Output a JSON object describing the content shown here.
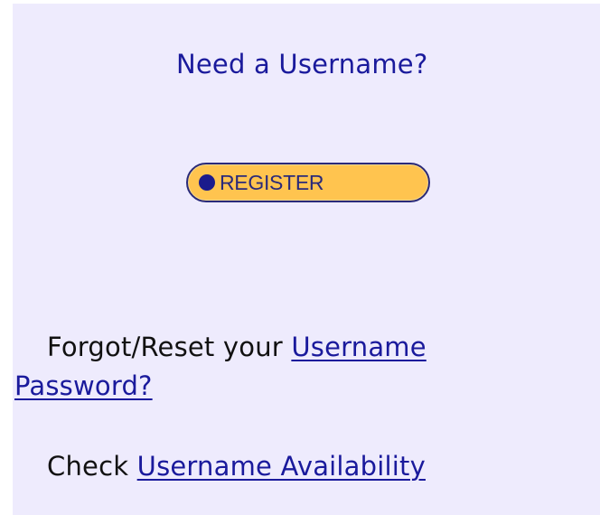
{
  "heading": "Need a Username?",
  "register_button": {
    "label": "REGISTER",
    "dot_color": "#1b1b8c",
    "fill_color": "#ffc44f"
  },
  "forgot": {
    "prefix": "Forgot/Reset your",
    "link_line1": "Username",
    "link_line2": "Password?"
  },
  "check": {
    "prefix": "Check",
    "link": "Username Availability"
  },
  "colors": {
    "background": "#eeebfd",
    "link": "#1a1a9c",
    "text": "#111111"
  }
}
